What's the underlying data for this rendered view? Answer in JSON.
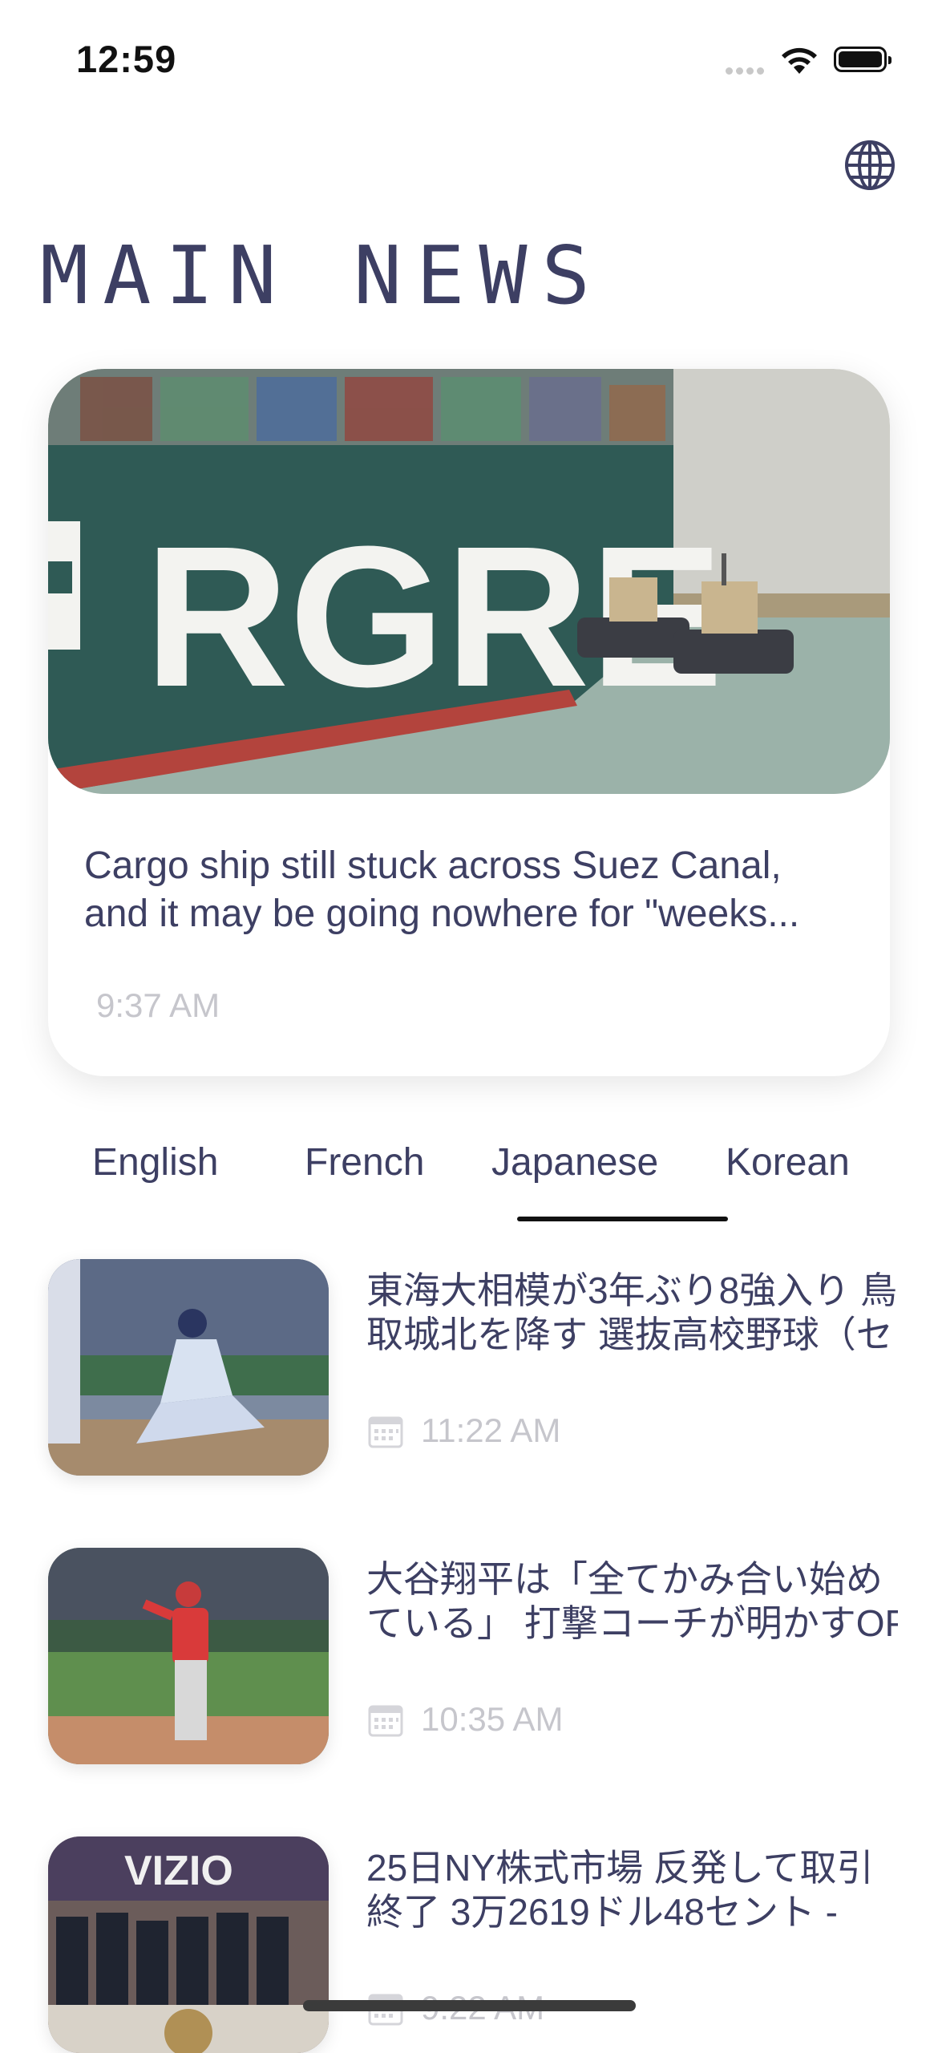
{
  "status_bar": {
    "time": "12:59"
  },
  "header": {
    "title": "MAIN NEWS",
    "language_icon": "globe-icon"
  },
  "featured": {
    "headline_line1": "Cargo ship still stuck across Suez Canal,",
    "headline_line2": "and it may be going nowhere for \"weeks...",
    "time": "9:37 AM",
    "image": "cargo-ship-photo"
  },
  "tabs": [
    {
      "label": "English",
      "selected": false
    },
    {
      "label": "French",
      "selected": false
    },
    {
      "label": "Japanese",
      "selected": true
    },
    {
      "label": "Korean",
      "selected": false
    }
  ],
  "news": [
    {
      "title_line1": "東海大相模が3年ぶり8強入り 鳥",
      "title_line2": "取城北を降す 選抜高校野球（セ",
      "time": "11:22 AM",
      "image": "baseball-slide-photo"
    },
    {
      "title_line1": "大谷翔平は「全てかみ合い始め",
      "title_line2": "ている」 打撃コーチが明かすOP",
      "time": "10:35 AM",
      "image": "baseball-player-photo"
    },
    {
      "title_line1": "25日NY株式市場 反発して取引",
      "title_line2": "終了 3万2619ドル48セント -",
      "time": "9:22 AM",
      "image": "stock-exchange-photo"
    }
  ],
  "colors": {
    "text": "#3d3f63",
    "muted": "#c6c6cc",
    "accent": "#111111"
  }
}
